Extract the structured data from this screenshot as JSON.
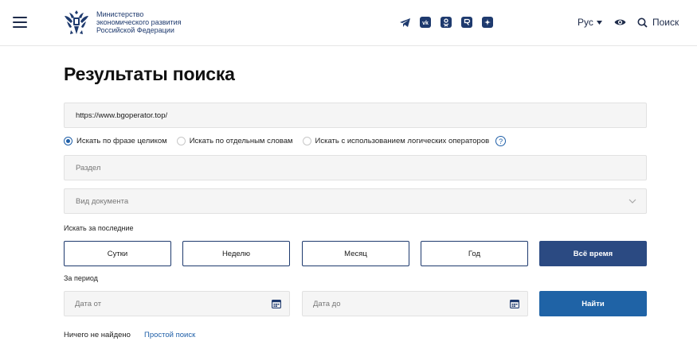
{
  "header": {
    "org_lines": [
      "Министерство",
      "экономического развития",
      "Российской Федерации"
    ],
    "socials": [
      "telegram-icon",
      "vk-icon",
      "odnoklassniki-icon",
      "rutube-icon",
      "dzen-icon"
    ],
    "lang": "Рус",
    "search_label": "Поиск"
  },
  "page": {
    "title": "Результаты поиска"
  },
  "form": {
    "query_value": "https://www.bgoperator.top/",
    "radios": [
      {
        "label": "Искать по фразе целиком",
        "checked": true
      },
      {
        "label": "Искать по отдельным словам",
        "checked": false
      },
      {
        "label": "Искать с использованием логических операторов",
        "checked": false
      }
    ],
    "section_placeholder": "Раздел",
    "doctype_placeholder": "Вид документа",
    "last_label": "Искать за последние",
    "periods": [
      "Сутки",
      "Неделю",
      "Месяц",
      "Год",
      "Всё время"
    ],
    "active_period": "Всё время",
    "period_label": "За период",
    "date_from": "Дата от",
    "date_to": "Дата до",
    "find_label": "Найти"
  },
  "results": {
    "empty_text": "Ничего не найдено",
    "simple_search": "Простой поиск"
  },
  "colors": {
    "accent": "#1f63a6",
    "active_period": "#2b4a82",
    "navy": "#1e2b4a"
  }
}
